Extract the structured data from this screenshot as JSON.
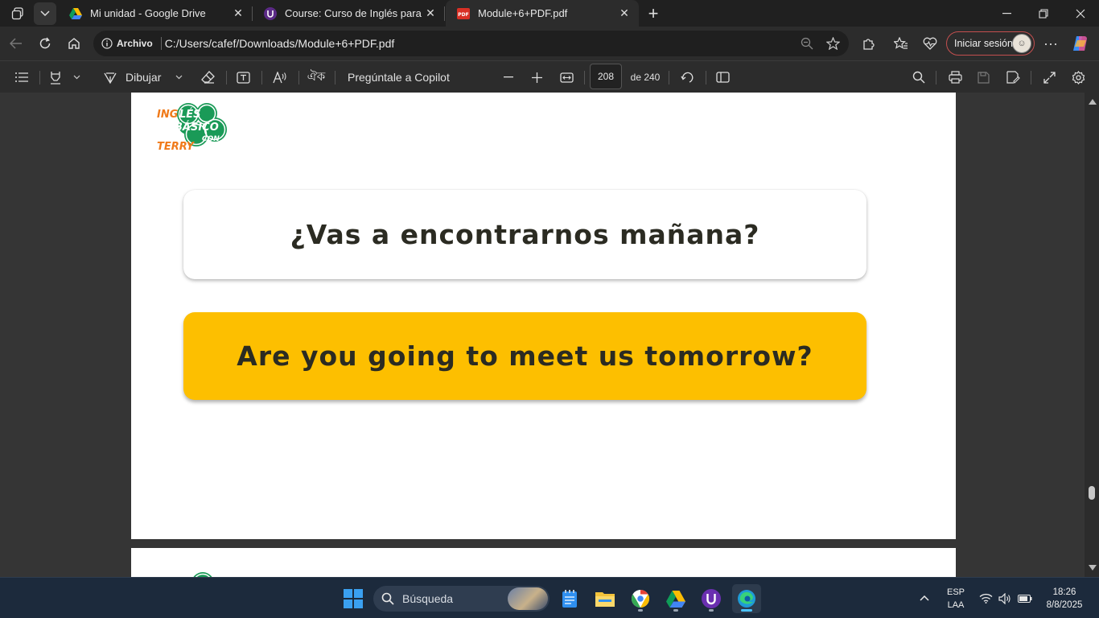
{
  "tabs": [
    {
      "title": "Mi unidad - Google Drive",
      "favicon": "google-drive-icon"
    },
    {
      "title": "Course: Curso de Inglés para principiantes",
      "favicon": "udemy-like-u-icon"
    },
    {
      "title": "Module+6+PDF.pdf",
      "favicon": "pdf-icon",
      "active": true
    }
  ],
  "address": {
    "scheme_label": "Archivo",
    "url": "C:/Users/cafef/Downloads/Module+6+PDF.pdf"
  },
  "profile": {
    "signin_label": "Iniciar sesión"
  },
  "pdf_toolbar": {
    "draw_label": "Dibujar",
    "copilot_label": "Pregúntale a Copilot",
    "page_number": "208",
    "page_total": "de 240"
  },
  "document": {
    "logo_text": [
      "INGLÉS",
      "BÁSICO",
      "CON",
      "TERRY"
    ],
    "spanish_phrase": "¿Vas a encontrarnos mañana?",
    "english_phrase": "Are you going to meet us tomorrow?"
  },
  "taskbar": {
    "search_placeholder": "Búsqueda",
    "lang_top": "ESP",
    "lang_bottom": "LAA",
    "time": "18:26",
    "date": "8/8/2025"
  },
  "colors": {
    "accent_yellow": "#fdbf00",
    "logo_green": "#1a9a57",
    "logo_orange": "#f07a1a",
    "signin_border": "#c44f4f"
  }
}
